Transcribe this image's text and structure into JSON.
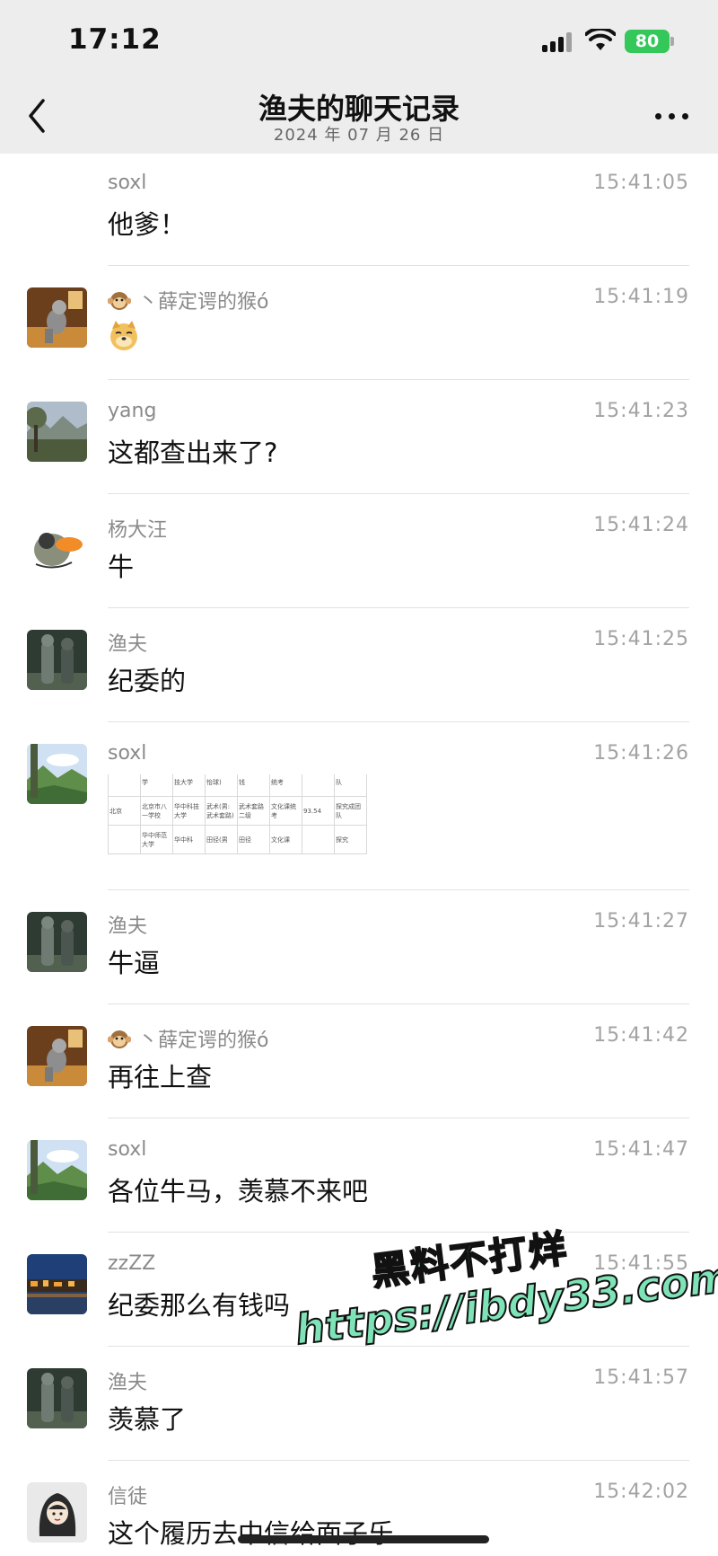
{
  "status_bar": {
    "time": "17:12",
    "battery": "80"
  },
  "header": {
    "back_icon": "chevron-left-icon",
    "title": "渔夫的聊天记录",
    "date": "2024 年 07 月 26 日",
    "more_icon": "ellipsis-icon"
  },
  "messages": [
    {
      "sender": "soxl",
      "time": "15:41:05",
      "text": "他爹！",
      "avatar": "none"
    },
    {
      "sender": "丶薛定谔的猴ó",
      "time": "15:41:19",
      "text": "",
      "content": "doge-emoji-sticker",
      "avatar": "monkey-avatar"
    },
    {
      "sender": "yang",
      "time": "15:41:23",
      "text": "这都查出来了?",
      "avatar": "landscape-avatar"
    },
    {
      "sender": "杨大汪",
      "time": "15:41:24",
      "text": "牛",
      "avatar": "cartoon-duck-avatar"
    },
    {
      "sender": "渔夫",
      "time": "15:41:25",
      "text": "纪委的",
      "avatar": "statue-avatar"
    },
    {
      "sender": "soxl",
      "time": "15:41:26",
      "text": "",
      "content": "table-image-thumbnail",
      "avatar": "mountain-avatar",
      "image_table": {
        "rows": [
          [
            "",
            "学",
            "技大学",
            "怡球)",
            "钱",
            "统考",
            "",
            "队"
          ],
          [
            "北京",
            "北京市八一学校",
            "华中科技大学",
            "武术(男:武术套路)",
            "武术套路二级",
            "文化课统考",
            "93.54",
            "探究成团队"
          ],
          [
            "",
            "华中师范大学",
            "华中科",
            "田径(男",
            "田径",
            "文化课",
            "",
            "探究"
          ]
        ]
      }
    },
    {
      "sender": "渔夫",
      "time": "15:41:27",
      "text": "牛逼",
      "avatar": "statue-avatar"
    },
    {
      "sender": "丶薛定谔的猴ó",
      "time": "15:41:42",
      "text": "再往上查",
      "avatar": "monkey-avatar"
    },
    {
      "sender": "soxl",
      "time": "15:41:47",
      "text": "各位牛马，羡慕不来吧",
      "avatar": "mountain-avatar"
    },
    {
      "sender": "zzZZ",
      "time": "15:41:55",
      "text": "纪委那么有钱吗",
      "avatar": "night-town-avatar"
    },
    {
      "sender": "渔夫",
      "time": "15:41:57",
      "text": "羡慕了",
      "avatar": "statue-avatar"
    },
    {
      "sender": "信徒",
      "time": "15:42:02",
      "text": "这个履历去中信给面子乐",
      "avatar": "hooded-girl-avatar"
    }
  ],
  "watermark": {
    "line1": "黑料不打烊",
    "line2": "https://ibdy33.com"
  },
  "colors": {
    "header_bg": "#ededed",
    "battery": "#34c759",
    "watermark": "#7ee3b7"
  }
}
